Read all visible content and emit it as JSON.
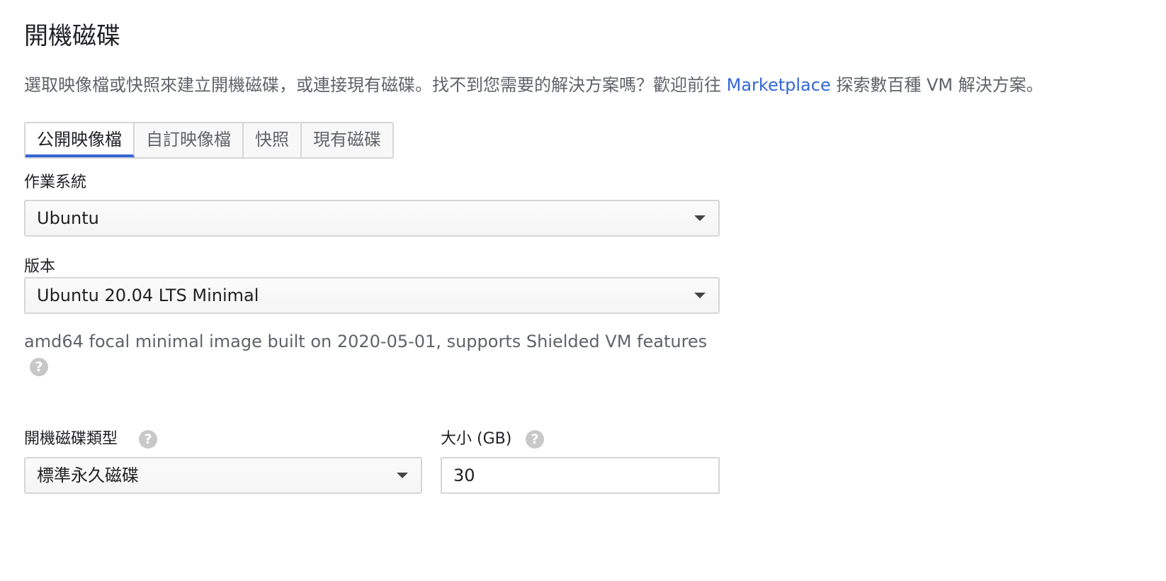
{
  "title": "開機磁碟",
  "description": {
    "before": "選取映像檔或快照來建立開機磁碟，或連接現有磁碟。找不到您需要的解決方案嗎？歡迎前往 ",
    "link": "Marketplace",
    "after": " 探索數百種 VM 解決方案。"
  },
  "tabs": [
    {
      "label": "公開映像檔",
      "active": true
    },
    {
      "label": "自訂映像檔",
      "active": false
    },
    {
      "label": "快照",
      "active": false
    },
    {
      "label": "現有磁碟",
      "active": false
    }
  ],
  "os": {
    "label": "作業系統",
    "value": "Ubuntu"
  },
  "version": {
    "label": "版本",
    "value": "Ubuntu 20.04 LTS Minimal"
  },
  "image_description": "amd64 focal minimal image built on 2020-05-01, supports Shielded VM features",
  "disk_type": {
    "label": "開機磁碟類型",
    "value": "標準永久磁碟"
  },
  "disk_size": {
    "label": "大小 (GB)",
    "value": "30"
  },
  "help_glyph": "?",
  "colors": {
    "link": "#3367d6",
    "tab_indicator": "#3367d6",
    "help_icon": "#c8c8c8"
  }
}
